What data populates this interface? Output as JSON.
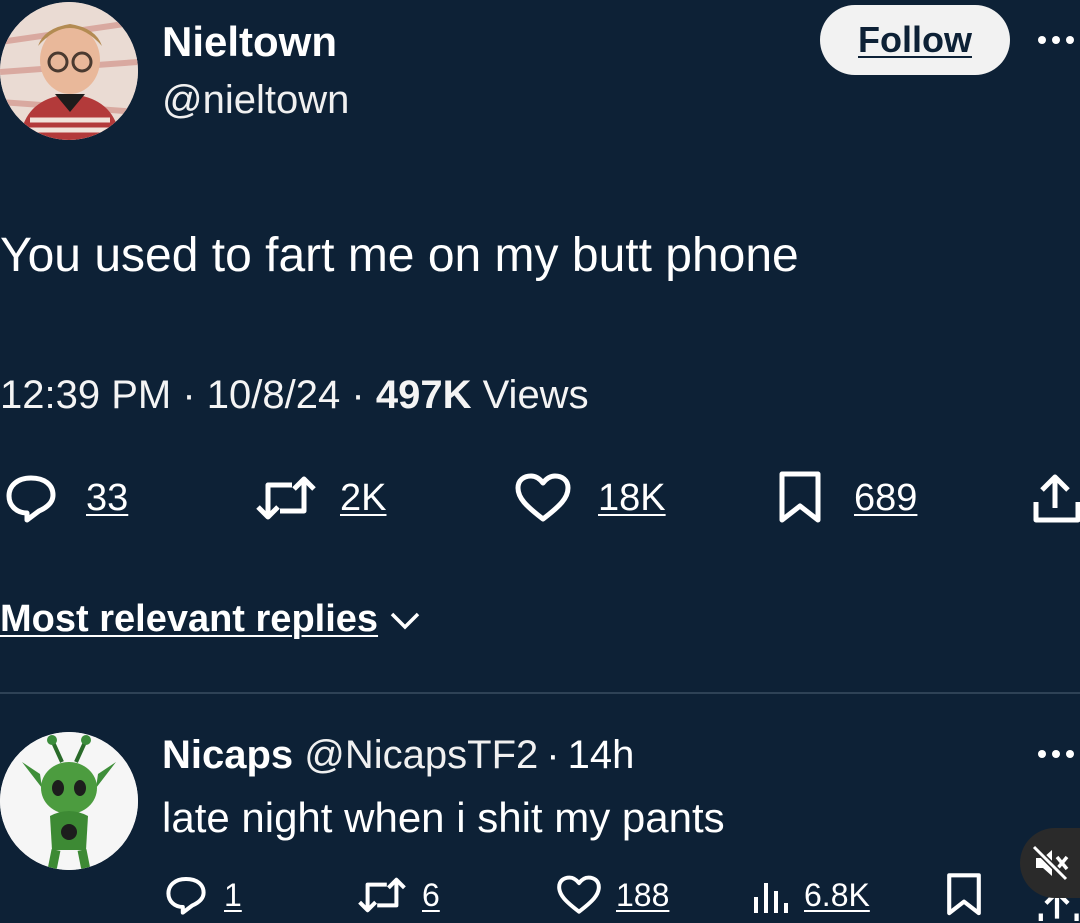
{
  "tweet": {
    "display_name": "Nieltown",
    "handle": "@nieltown",
    "follow_label": "Follow",
    "text": "You used to fart me on my butt phone",
    "time": "12:39 PM",
    "dot": "·",
    "date": "10/8/24",
    "views_count": "497K",
    "views_label": "Views",
    "stats": {
      "replies": "33",
      "reposts": "2K",
      "likes": "18K",
      "bookmarks": "689"
    }
  },
  "replies_sort": {
    "label": "Most relevant replies"
  },
  "reply": {
    "display_name": "Nicaps",
    "handle": "@NicapsTF2",
    "dot": "·",
    "time": "14h",
    "text": "late night when i shit my pants",
    "stats": {
      "replies": "1",
      "reposts": "6",
      "likes": "188",
      "views": "6.8K"
    }
  },
  "icons": {
    "more": "more-dots-icon",
    "reply": "reply-bubble-icon",
    "repost": "repost-icon",
    "like": "heart-icon",
    "bookmark": "bookmark-icon",
    "share": "share-icon",
    "views": "bar-chart-icon",
    "mute": "mute-icon"
  },
  "colors": {
    "background": "#0d2136",
    "text": "#ffffff",
    "follow_bg": "#f2f2f2",
    "follow_text": "#0d2136",
    "divider": "#2e4256"
  }
}
